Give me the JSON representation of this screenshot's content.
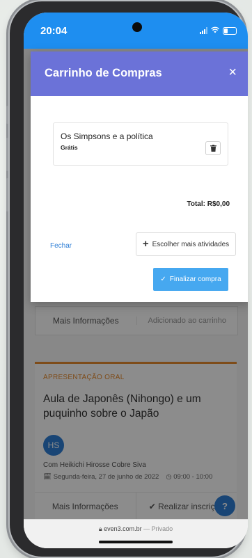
{
  "status_bar": {
    "time": "20:04"
  },
  "page": {
    "prev_card": {
      "more_info": "Mais Informações",
      "added": "Adicionado ao carrinho"
    },
    "event": {
      "type": "APRESENTAÇÃO ORAL",
      "title": "Aula de Japonês (Nihongo) e um puquinho sobre o Japão",
      "avatar_initials": "HS",
      "speaker": "Com Heikichi Hirosse Cobre Siva",
      "date": "Segunda-feira, 27 de junho de 2022",
      "time": "09:00 - 10:00",
      "more_info": "Mais Informações",
      "register": "Realizar inscrição"
    }
  },
  "modal": {
    "title": "Carrinho de Compras",
    "close_symbol": "×",
    "items": [
      {
        "name": "Os Simpsons e a política",
        "price": "Grátis"
      }
    ],
    "total": "Total: R$0,00",
    "close_link": "Fechar",
    "choose_more": "Escolher mais atividades",
    "checkout": "Finalizar compra"
  },
  "browser": {
    "domain": "even3.com.br",
    "mode": " — Privado"
  },
  "colors": {
    "status_bar": "#1e8ef0",
    "modal_header": "#6b72d8",
    "checkout_button": "#46a8f0",
    "accent_orange": "#e68a2e",
    "link": "#2f7fd6"
  }
}
